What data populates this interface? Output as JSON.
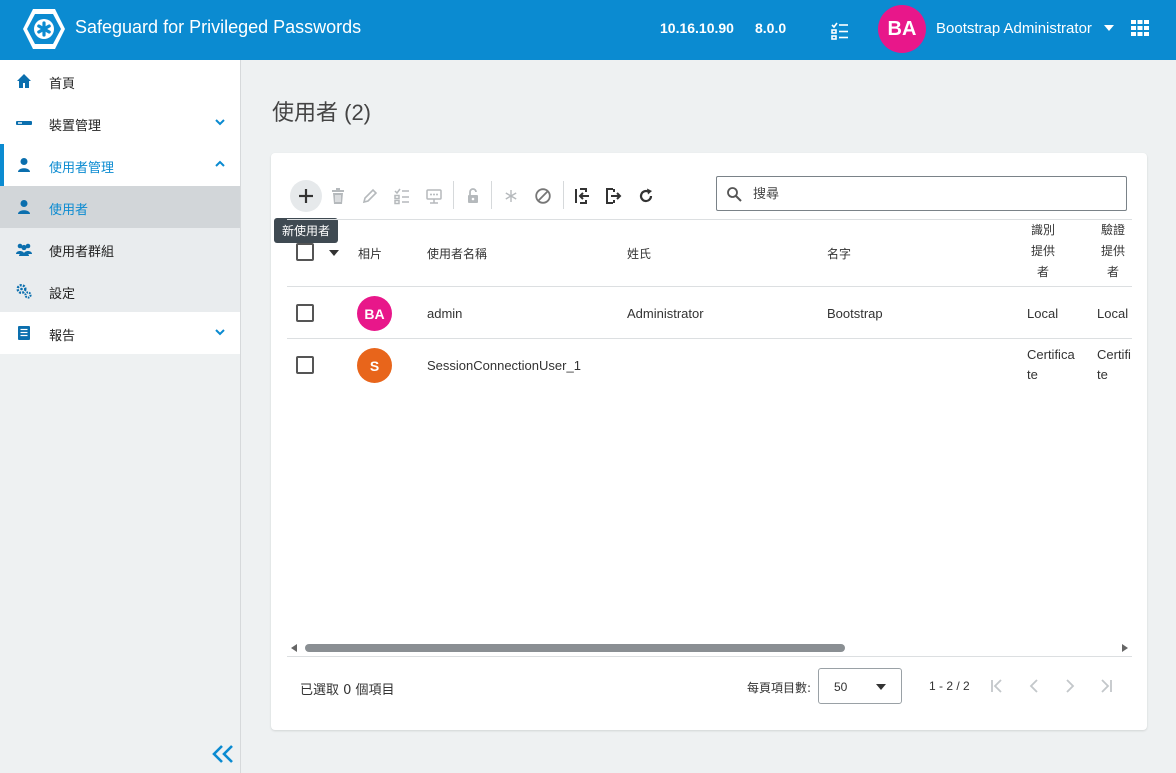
{
  "header": {
    "app_title": "Safeguard for Privileged Passwords",
    "ip": "10.16.10.90",
    "version": "8.0.0",
    "user_initials": "BA",
    "user_name": "Bootstrap Administrator",
    "brand_color": "#0b8bd1",
    "avatar_color": "#e8178a"
  },
  "sidebar": {
    "items": [
      {
        "label": "首頁",
        "icon": "home-icon"
      },
      {
        "label": "裝置管理",
        "icon": "device-icon"
      },
      {
        "label": "使用者管理",
        "icon": "user-icon"
      },
      {
        "label": "使用者",
        "icon": "user-icon"
      },
      {
        "label": "使用者群組",
        "icon": "users-group-icon"
      },
      {
        "label": "設定",
        "icon": "settings-gears-icon"
      },
      {
        "label": "報告",
        "icon": "report-icon"
      }
    ]
  },
  "main": {
    "page_title": "使用者 (2)",
    "tooltip": "新使用者",
    "search_placeholder": "搜尋",
    "columns": {
      "photo": "相片",
      "username": "使用者名稱",
      "last_name": "姓氏",
      "first_name": "名字",
      "identity_provider": [
        "識別",
        "提供",
        "者"
      ],
      "auth_provider": [
        "驗證",
        "提供",
        "者"
      ]
    },
    "rows": [
      {
        "initials": "BA",
        "avatar_color": "#e8178a",
        "username": "admin",
        "last_name": "Administrator",
        "first_name": "Bootstrap",
        "identity_provider": [
          "Local"
        ],
        "auth_provider": [
          "Local"
        ]
      },
      {
        "initials": "S",
        "avatar_color": "#e8651b",
        "username": "SessionConnectionUser_1",
        "last_name": "",
        "first_name": "",
        "identity_provider": [
          "Certifica",
          "te"
        ],
        "auth_provider": [
          "Certifi",
          "te"
        ]
      }
    ],
    "footer": {
      "selected_count": "已選取 0 個項目",
      "per_page_label": "每頁項目數:",
      "per_page_value": "50",
      "range": "1 - 2 / 2"
    }
  }
}
